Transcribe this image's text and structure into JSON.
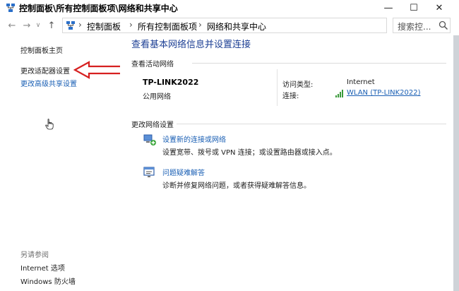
{
  "window": {
    "title": "控制面板\\所有控制面板项\\网络和共享中心",
    "minimize_glyph": "—",
    "maximize_glyph": "☐",
    "close_glyph": "✕"
  },
  "nav": {
    "back_glyph": "←",
    "forward_glyph": "→",
    "recent_glyph": "∨",
    "up_glyph": "↑",
    "breadcrumbs": [
      "控制面板",
      "所有控制面板项",
      "网络和共享中心"
    ],
    "separator": "›",
    "dropdown_glyph": "∨",
    "refresh_glyph": "↻",
    "search_placeholder": "搜索控..."
  },
  "sidebar": {
    "home": "控制面板主页",
    "adapter_settings": "更改适配器设置",
    "advanced_sharing": "更改高级共享设置",
    "see_also": "另请参阅",
    "internet_options": "Internet 选项",
    "firewall": "Windows 防火墙"
  },
  "main": {
    "title": "查看基本网络信息并设置连接",
    "active_networks_header": "查看活动网络",
    "network": {
      "name": "TP-LINK2022",
      "category": "公用网络",
      "access_type_label": "访问类型:",
      "access_type_value": "Internet",
      "connections_label": "连接:",
      "connection_value": "WLAN (TP-LINK2022)"
    },
    "change_settings_header": "更改网络设置",
    "tasks": [
      {
        "link": "设置新的连接或网络",
        "description": "设置宽带、拨号或 VPN 连接；或设置路由器或接入点。"
      },
      {
        "link": "问题疑难解答",
        "description": "诊断并修复网络问题，或者获得疑难解答信息。"
      }
    ]
  },
  "colors": {
    "link": "#1a5fb4",
    "title_blue": "#1c3f94",
    "annotation_red": "#d62020"
  },
  "icons": {
    "app": "network-center-icon",
    "annotation": "red-arrow-icon",
    "cursor": "hand-cursor-icon"
  }
}
